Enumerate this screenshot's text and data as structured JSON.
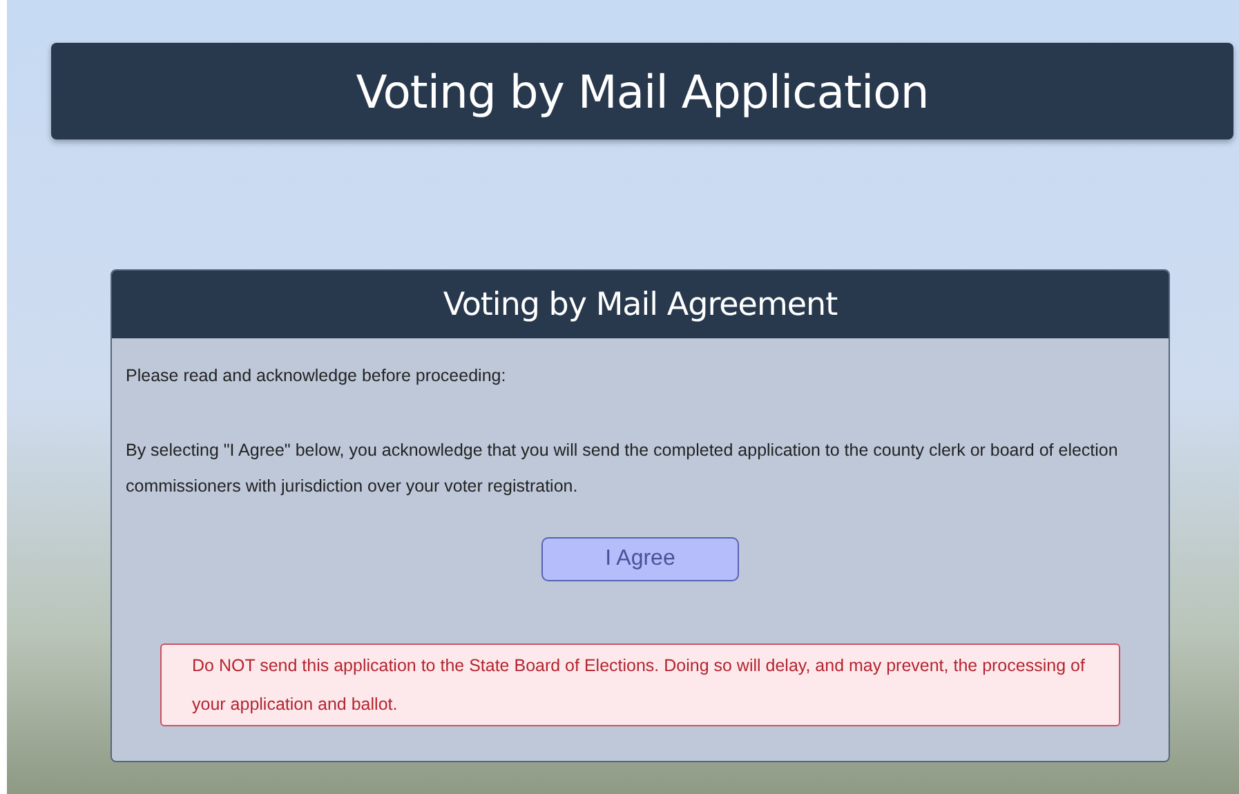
{
  "header": {
    "title": "Voting by Mail Application"
  },
  "agreement": {
    "title": "Voting by Mail Agreement",
    "intro": "Please read and acknowledge before proceeding:",
    "body": "By selecting \"I Agree\" below, you acknowledge that you will send the completed application to the county clerk or board of election commissioners with jurisdiction over your voter registration.",
    "button": "I Agree",
    "warning": "Do NOT send this application to the State Board of Elections. Doing so will delay, and may prevent, the processing of your application and ballot."
  }
}
